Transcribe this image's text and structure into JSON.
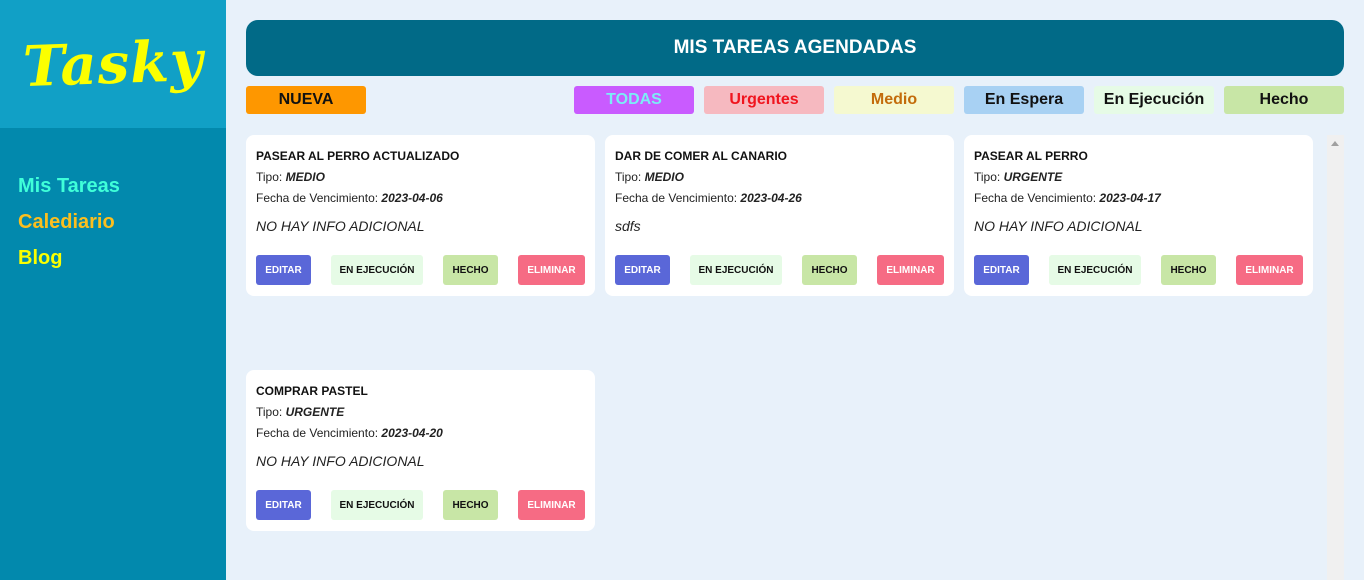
{
  "sidebar": {
    "logo": "Tasky",
    "nav": [
      {
        "label": "Mis Tareas",
        "color": "#3fffd9"
      },
      {
        "label": "Calediario",
        "color": "#fcbf1e"
      },
      {
        "label": "Blog",
        "color": "#fbff00"
      }
    ]
  },
  "header": {
    "title": "MIS TAREAS AGENDADAS"
  },
  "toolbar": {
    "new_label": "NUEVA",
    "filters": [
      {
        "label": "TODAS",
        "bg": "#c95bff",
        "color": "#7cecf6"
      },
      {
        "label": "Urgentes",
        "bg": "#f6b9c0",
        "color": "#f0141e"
      },
      {
        "label": "Medio",
        "bg": "#f5f9d0",
        "color": "#c36c0b"
      },
      {
        "label": "En Espera",
        "bg": "#a8d1f3",
        "color": "#111111"
      },
      {
        "label": "En Ejecución",
        "bg": "#e6fbe6",
        "color": "#111111"
      },
      {
        "label": "Hecho",
        "bg": "#c8e6a6",
        "color": "#111111"
      }
    ]
  },
  "labels": {
    "tipo": "Tipo:",
    "fecha": "Fecha de Vencimiento:",
    "editar": "EDITAR",
    "ejecucion": "EN EJECUCIÓN",
    "hecho": "HECHO",
    "eliminar": "ELIMINAR"
  },
  "tasks": [
    {
      "title": "PASEAR AL PERRO ACTUALIZADO",
      "tipo": "MEDIO",
      "fecha": "2023-04-06",
      "info": "NO HAY INFO ADICIONAL"
    },
    {
      "title": "DAR DE COMER AL CANARIO",
      "tipo": "MEDIO",
      "fecha": "2023-04-26",
      "info": "sdfs"
    },
    {
      "title": "PASEAR AL PERRO",
      "tipo": "URGENTE",
      "fecha": "2023-04-17",
      "info": "NO HAY INFO ADICIONAL"
    },
    {
      "title": "COMPRAR PASTEL",
      "tipo": "URGENTE",
      "fecha": "2023-04-20",
      "info": "NO HAY INFO ADICIONAL"
    }
  ]
}
